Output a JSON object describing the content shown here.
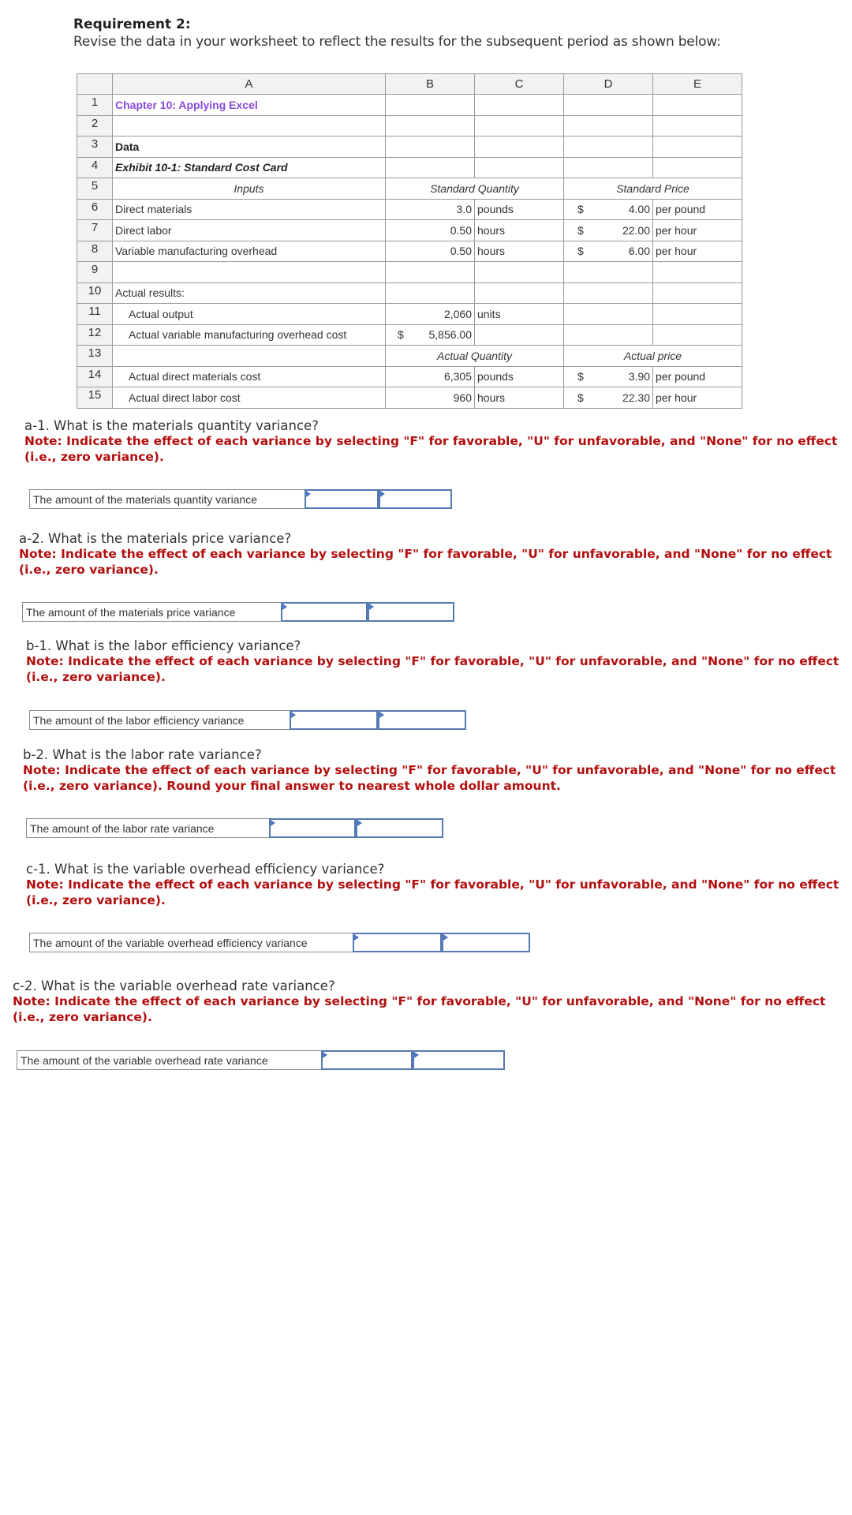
{
  "requirement": {
    "title": "Requirement 2:",
    "text": "Revise the data in your worksheet to reflect the results for the subsequent period as shown below:"
  },
  "sheet": {
    "columns": [
      "",
      "A",
      "B",
      "C",
      "D",
      "E"
    ],
    "rows": [
      {
        "n": "1",
        "a": "Chapter 10: Applying Excel"
      },
      {
        "n": "2"
      },
      {
        "n": "3",
        "a": "Data"
      },
      {
        "n": "4",
        "a": "Exhibit 10-1: Standard Cost Card"
      },
      {
        "n": "5",
        "a": "Inputs",
        "bc": "Standard Quantity",
        "de": "Standard Price"
      },
      {
        "n": "6",
        "a": "Direct materials",
        "b": "3.0",
        "c": "pounds",
        "d_sym": "$",
        "d": "4.00",
        "e": "per pound"
      },
      {
        "n": "7",
        "a": "Direct labor",
        "b": "0.50",
        "c": "hours",
        "d_sym": "$",
        "d": "22.00",
        "e": "per hour"
      },
      {
        "n": "8",
        "a": "Variable manufacturing overhead",
        "b": "0.50",
        "c": "hours",
        "d_sym": "$",
        "d": "6.00",
        "e": "per hour"
      },
      {
        "n": "9"
      },
      {
        "n": "10",
        "a": "Actual results:"
      },
      {
        "n": "11",
        "a": "Actual output",
        "b": "2,060",
        "c": "units"
      },
      {
        "n": "12",
        "a": "Actual variable manufacturing overhead cost",
        "b_sym": "$",
        "b": "5,856.00"
      },
      {
        "n": "13",
        "bc": "Actual Quantity",
        "de": "Actual price"
      },
      {
        "n": "14",
        "a": "Actual direct materials cost",
        "b": "6,305",
        "c": "pounds",
        "d_sym": "$",
        "d": "3.90",
        "e": "per pound"
      },
      {
        "n": "15",
        "a": "Actual direct labor cost",
        "b": "960",
        "c": "hours",
        "d_sym": "$",
        "d": "22.30",
        "e": "per hour"
      }
    ]
  },
  "questions": [
    {
      "title": "a-1. What is the materials quantity variance?",
      "note": "Note: Indicate the effect of each variance by selecting \"F\" for favorable, \"U\" for unfavorable, and \"None\" for no effect (i.e., zero variance).",
      "answer_label": "The amount of the materials quantity variance",
      "amount_value": "",
      "effect_value": ""
    },
    {
      "title": "a-2. What is the materials price variance?",
      "note": "Note: Indicate the effect of each variance by selecting \"F\" for favorable, \"U\" for unfavorable, and \"None\" for no effect (i.e., zero variance).",
      "answer_label": "The amount of the materials price variance",
      "amount_value": "",
      "effect_value": ""
    },
    {
      "title": "b-1. What is the labor efficiency variance?",
      "note": "Note: Indicate the effect of each variance by selecting \"F\" for favorable, \"U\" for unfavorable, and \"None\" for no effect (i.e., zero variance).",
      "answer_label": "The amount of the labor efficiency variance",
      "amount_value": "",
      "effect_value": ""
    },
    {
      "title": "b-2. What is the labor rate variance?",
      "note": "Note: Indicate the effect of each variance by selecting \"F\" for favorable, \"U\" for unfavorable, and \"None\" for no effect (i.e., zero variance). Round your final answer to nearest whole dollar amount.",
      "answer_label": "The amount of the labor rate variance",
      "amount_value": "",
      "effect_value": ""
    },
    {
      "title": "c-1. What is the variable overhead efficiency variance?",
      "note": "Note: Indicate the effect of each variance by selecting \"F\" for favorable, \"U\" for unfavorable, and \"None\" for no effect (i.e., zero variance).",
      "answer_label": "The amount of the variable overhead efficiency variance",
      "amount_value": "",
      "effect_value": ""
    },
    {
      "title": "c-2. What is the variable overhead rate variance?",
      "note": "Note: Indicate the effect of each variance by selecting \"F\" for favorable, \"U\" for unfavorable, and \"None\" for no effect (i.e., zero variance).",
      "answer_label": "The amount of the variable overhead rate variance",
      "amount_value": "",
      "effect_value": ""
    }
  ]
}
